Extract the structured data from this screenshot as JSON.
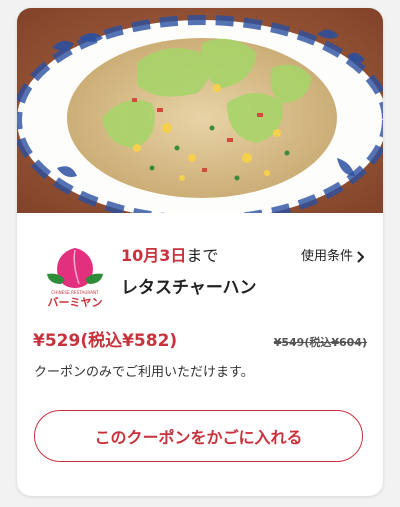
{
  "coupon": {
    "image_alt": "fried-rice-with-lettuce-photo",
    "brand": {
      "logo_small_text": "CHINESE RESTAURANT",
      "logo_text": "バーミヤン",
      "peach_color": "#e2307f",
      "leaf_color": "#2e8b3a"
    },
    "expiry": {
      "date": "10月3日",
      "suffix": "まで"
    },
    "terms_label": "使用条件",
    "product_name": "レタスチャーハン",
    "price": {
      "current": "¥529(税込¥582)",
      "original": "¥549(税込¥604)"
    },
    "note": "クーポンのみでご利用いただけます。",
    "cta_label": "このクーポンをかごに入れる",
    "accent_color": "#c8323c"
  }
}
